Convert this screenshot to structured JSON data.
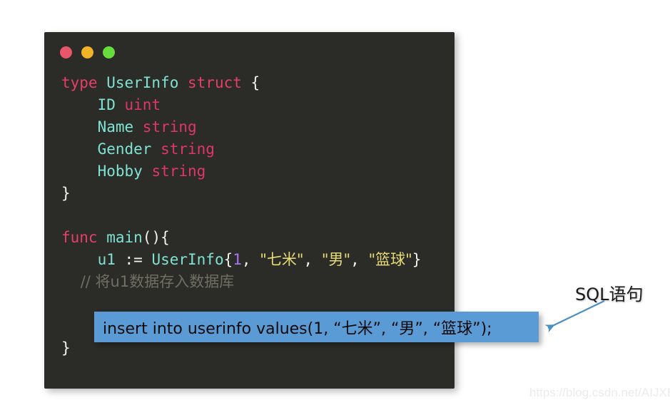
{
  "page": {
    "background_color": "#ffffff"
  },
  "code_window": {
    "background_color": "#2b2b27",
    "titlebar": {
      "buttons": [
        {
          "name": "close",
          "icon": "traffic-light-close-icon",
          "color": "#e8566b"
        },
        {
          "name": "minimize",
          "icon": "traffic-light-minimize-icon",
          "color": "#f0b429"
        },
        {
          "name": "maximize",
          "icon": "traffic-light-maximize-icon",
          "color": "#66dd3c"
        }
      ]
    },
    "language": "Go",
    "lines": [
      {
        "id": "line-type-userinfo",
        "tokens": [
          {
            "text": "type ",
            "kind": "keyword"
          },
          {
            "text": "UserInfo ",
            "kind": "identifier"
          },
          {
            "text": "struct ",
            "kind": "keyword"
          },
          {
            "text": "{",
            "kind": "punctuation"
          }
        ]
      },
      {
        "id": "line-field-id",
        "tokens": [
          {
            "text": "    ID ",
            "kind": "identifier"
          },
          {
            "text": "uint",
            "kind": "type"
          }
        ]
      },
      {
        "id": "line-field-name",
        "tokens": [
          {
            "text": "    Name ",
            "kind": "identifier"
          },
          {
            "text": "string",
            "kind": "type"
          }
        ]
      },
      {
        "id": "line-field-gender",
        "tokens": [
          {
            "text": "    Gender ",
            "kind": "identifier"
          },
          {
            "text": "string",
            "kind": "type"
          }
        ]
      },
      {
        "id": "line-field-hobby",
        "tokens": [
          {
            "text": "    Hobby ",
            "kind": "identifier"
          },
          {
            "text": "string",
            "kind": "type"
          }
        ]
      },
      {
        "id": "line-struct-close",
        "tokens": [
          {
            "text": "}",
            "kind": "punctuation"
          }
        ]
      },
      {
        "id": "line-blank-1",
        "tokens": []
      },
      {
        "id": "line-func-main",
        "tokens": [
          {
            "text": "func ",
            "kind": "keyword"
          },
          {
            "text": "main",
            "kind": "identifier"
          },
          {
            "text": "(){",
            "kind": "punctuation"
          }
        ]
      },
      {
        "id": "line-u1-assign",
        "tokens": [
          {
            "text": "    u1 ",
            "kind": "identifier"
          },
          {
            "text": ":= ",
            "kind": "punctuation"
          },
          {
            "text": "UserInfo",
            "kind": "identifier"
          },
          {
            "text": "{",
            "kind": "punctuation"
          },
          {
            "text": "1",
            "kind": "number"
          },
          {
            "text": ", ",
            "kind": "punctuation"
          },
          {
            "text": "\"七米\"",
            "kind": "string"
          },
          {
            "text": ", ",
            "kind": "punctuation"
          },
          {
            "text": "\"男\"",
            "kind": "string"
          },
          {
            "text": ", ",
            "kind": "punctuation"
          },
          {
            "text": "\"篮球\"",
            "kind": "string"
          },
          {
            "text": "}",
            "kind": "punctuation"
          }
        ]
      },
      {
        "id": "line-comment",
        "tokens": [
          {
            "text": "    // 将u1数据存入数据库",
            "kind": "comment"
          }
        ]
      },
      {
        "id": "line-blank-2",
        "tokens": []
      },
      {
        "id": "line-blank-3",
        "tokens": []
      },
      {
        "id": "line-func-close",
        "tokens": [
          {
            "text": "}",
            "kind": "punctuation"
          }
        ]
      }
    ]
  },
  "sql_callout": {
    "text": "insert into userinfo values(1, “七米”, “男”, “篮球”);",
    "background_color": "#5b9bd5",
    "text_color": "#0a0a0a"
  },
  "annotation": {
    "label": "SQL语句",
    "arrow_color": "#4a8fc4",
    "arrow_icon": "arrow-down-left-icon"
  },
  "watermark": {
    "text": "https://blog.csdn.net/AIJXB",
    "color": "#ebebeb"
  }
}
